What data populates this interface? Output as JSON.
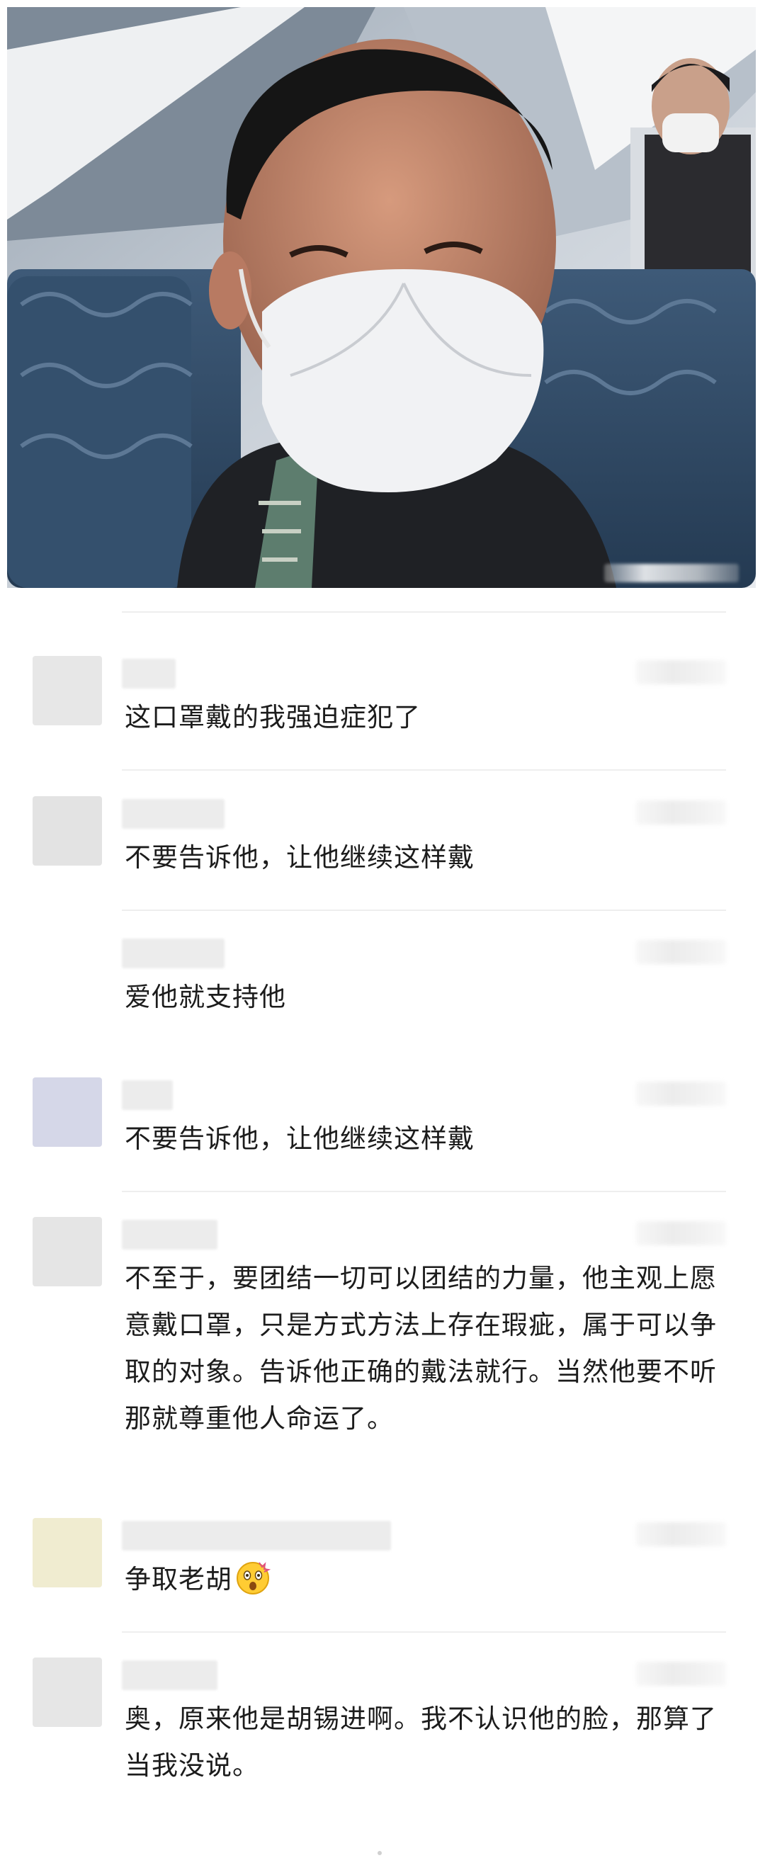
{
  "photo": {
    "alt_description_icon": "airplane-selfie-photo"
  },
  "comments": [
    {
      "text": "这口罩戴的我强迫症犯了",
      "avatar_color": "#e7e7e7"
    },
    {
      "text": "不要告诉他，让他继续这样戴",
      "avatar_color": "#e3e3e3"
    },
    {
      "text": "爱他就支持他",
      "avatar_color": null
    },
    {
      "text": "不要告诉他，让他继续这样戴",
      "avatar_color": "#d5d7e8"
    },
    {
      "text": "不至于，要团结一切可以团结的力量，他主观上愿意戴口罩，只是方式方法上存在瑕疵，属于可以争取的对象。告诉他正确的戴法就行。当然他要不听那就尊重他人命运了。",
      "avatar_color": "#e5e5e5"
    },
    {
      "text": "争取老胡",
      "emoji": "astonished-face-icon",
      "avatar_color": "#f0ecd0"
    },
    {
      "text": "奥，原来他是胡锡进啊。我不认识他的脸，那算了当我没说。",
      "avatar_color": "#e6e6e6"
    }
  ],
  "colors": {
    "text": "#1c1c1c",
    "divider": "#eeeeee",
    "background": "#ffffff"
  }
}
